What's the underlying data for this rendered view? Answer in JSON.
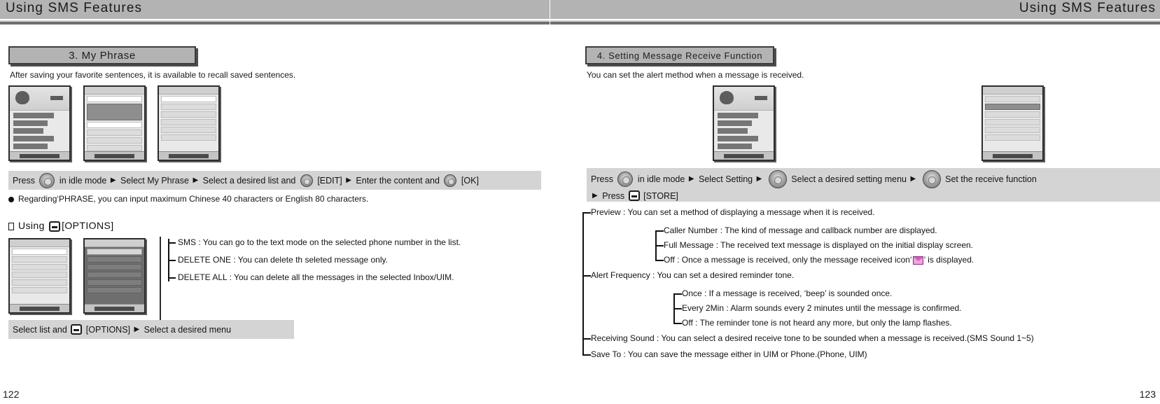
{
  "spread": {
    "header_left": "Using SMS Features",
    "header_right": "Using SMS Features",
    "folio_left": "122",
    "folio_right": "123"
  },
  "left_page": {
    "section_title": "3. My Phrase",
    "lede": "After saving your favorite sentences, it is available to recall saved sentences.",
    "steps": {
      "press": "Press",
      "in_idle_mode": "in idle mode",
      "select_my_phrase": "Select My Phrase",
      "select_list": "Select a desired list and",
      "edit_label": "[EDIT]",
      "enter_content": "Enter the content and",
      "ok_label": "[OK]",
      "arrow": "▶"
    },
    "note": "Regarding‘PHRASE, you can input maximum Chinese 40 characters or English 80 characters.",
    "subhead": {
      "prefix": "Using",
      "options_label": "[OPTIONS]"
    },
    "options": [
      "SMS : You can go to the text mode on the selected phone number in the list.",
      "DELETE ONE : You can delete th seleted message only.",
      "DELETE ALL : You can delete all the messages in the selected Inbox/UIM."
    ],
    "bottom_steps": {
      "select_list_and": "Select list and",
      "options_label": "[OPTIONS]",
      "arrow": "▶",
      "select_menu": "Select a desired menu"
    }
  },
  "right_page": {
    "section_title": "4. Setting Message Receive Function",
    "lede": "You can set the alert method when a message is received.",
    "steps": {
      "press": "Press",
      "in_idle_mode": "in idle mode",
      "select_setting": "Select Setting",
      "select_setting_menu": "Select a desired setting menu",
      "set_receive_function": "Set the receive function",
      "press2": "Press",
      "store_label": "[STORE]",
      "arrow": "▶"
    },
    "tree": [
      {
        "label": "Preview : You can set a method of displaying a message when it is received.",
        "children": [
          "Caller Number : The kind of message and callback number are displayed.",
          "Full Message : The received text message is displayed on the initial display screen.",
          "Off : Once a message is received, only the message received icon‘ ’ is displayed."
        ]
      },
      {
        "label": "Alert Frequency : You can set a desired reminder tone.",
        "children": [
          "Once : If a message is received, ‘beep’ is sounded once.",
          "Every 2Min : Alarm sounds every 2 minutes until the message is confirmed.",
          "Off : The reminder tone is not heard any more, but only the lamp flashes."
        ]
      },
      {
        "label": "Receiving Sound : You can select a desired receive tone to be sounded when a message is received.(SMS Sound 1~5)",
        "children": []
      },
      {
        "label": "Save To : You can save the message either in UIM or Phone.(Phone, UIM)",
        "children": []
      }
    ],
    "off_line_parts": {
      "before_icon": "Off : Once a message is received, only the message received icon‘",
      "after_icon": "’ is displayed."
    }
  }
}
